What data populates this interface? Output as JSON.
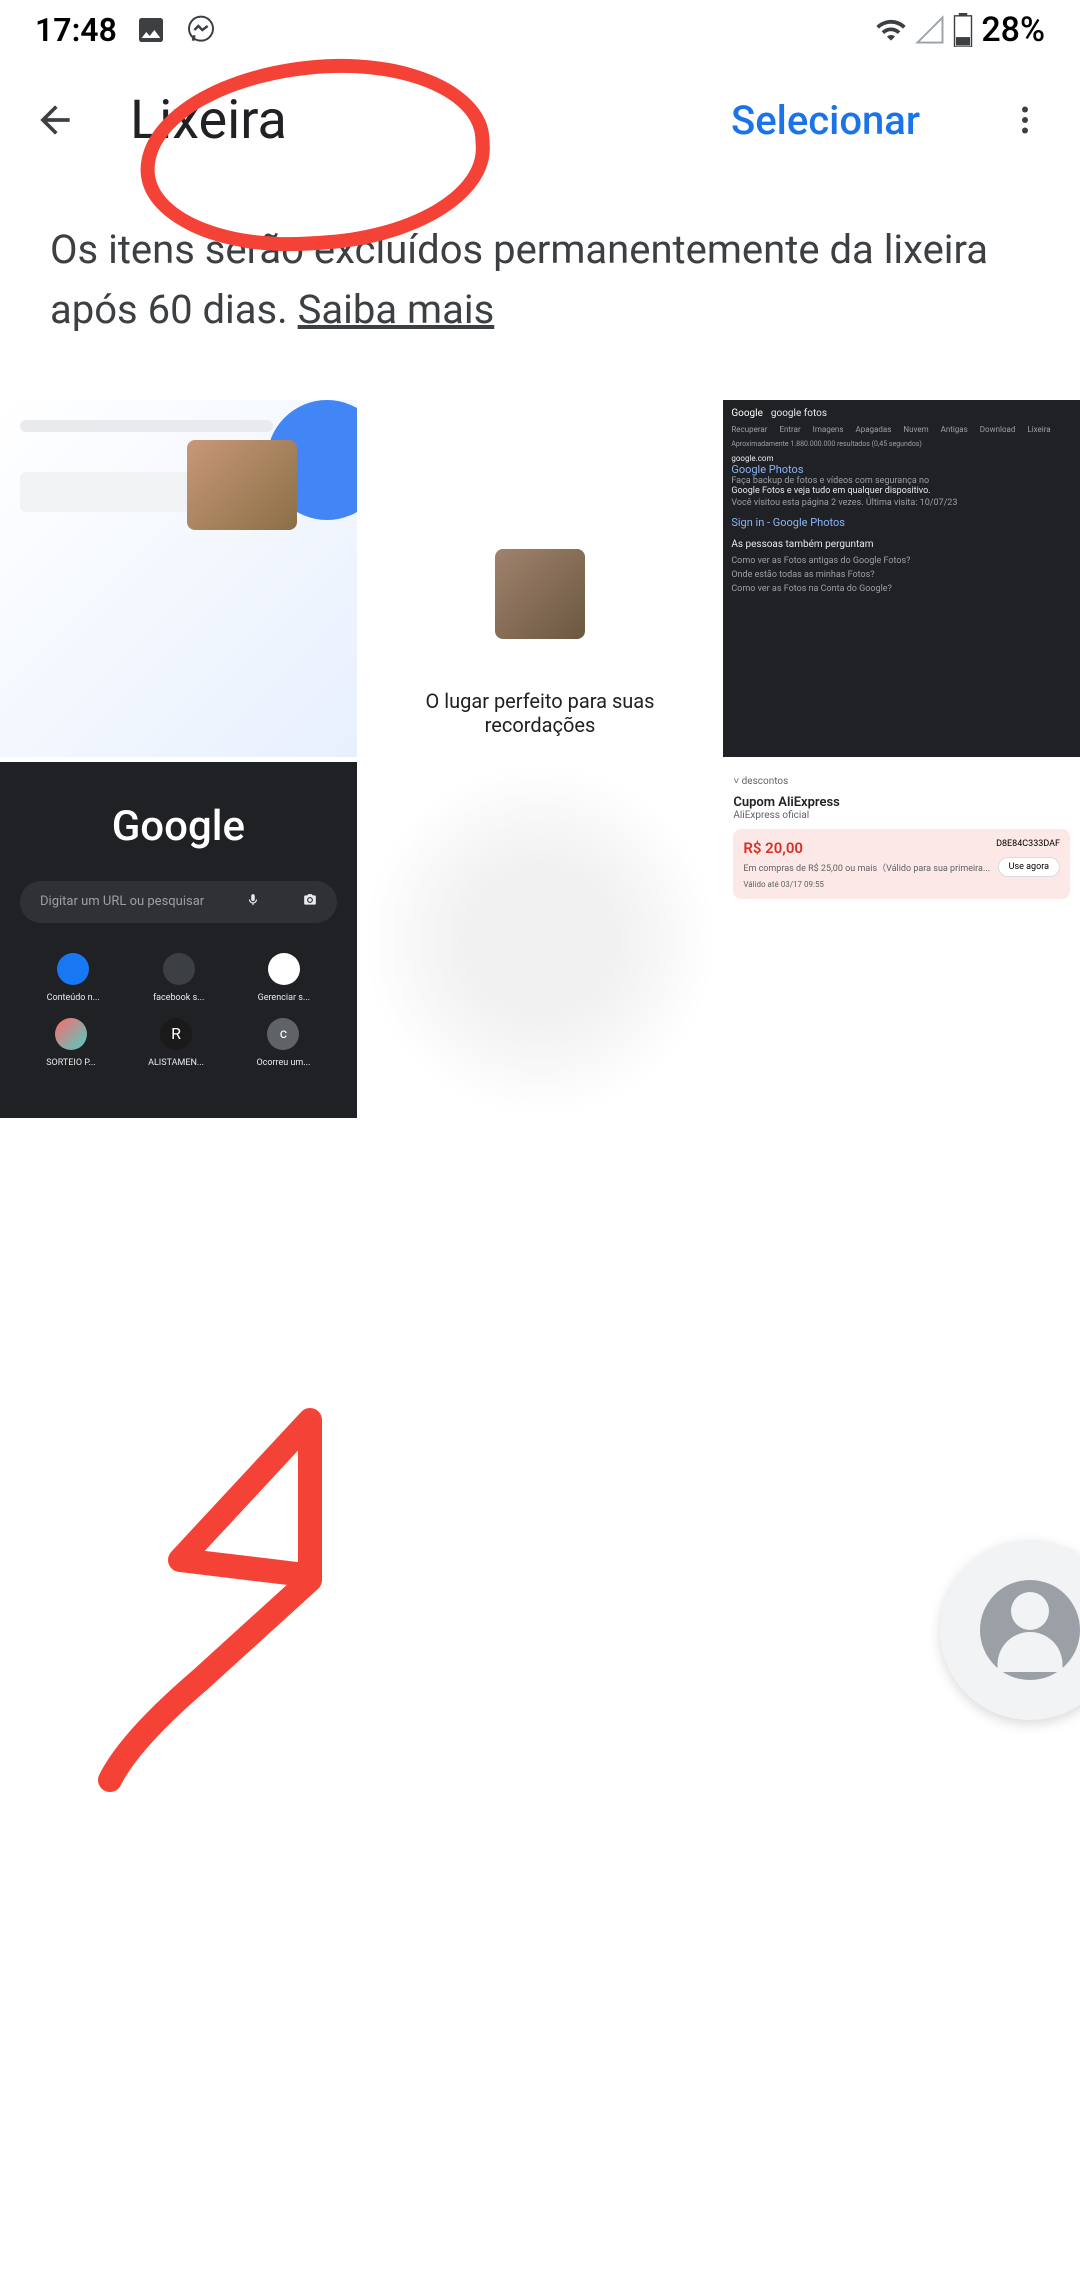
{
  "status_bar": {
    "time": "17:48",
    "battery_percent": "28%"
  },
  "app_bar": {
    "title": "Lixeira",
    "select_label": "Selecionar"
  },
  "info_banner": {
    "text": "Os itens serão excluídos permanentemente da lixeira após 60 dias. ",
    "link_text": "Saiba mais"
  },
  "thumbnails": {
    "photo2_caption": "O lugar perfeito para suas recordações",
    "photo3": {
      "search_term": "google fotos",
      "tabs": [
        "Recuperar",
        "Entrar",
        "Imagens",
        "Apagadas",
        "Nuvem",
        "Antigas",
        "Download",
        "Lixeira"
      ],
      "result_count": "Aproximadamente 1.880.000.000 resultados (0,45 segundos)",
      "url1": "google.com",
      "title1": "Google Photos",
      "desc1": "Faça backup de fotos e vídeos com segurança no",
      "desc1b": "Google Fotos e veja tudo em qualquer dispositivo.",
      "visited": "Você visitou esta página 2 vezes. Última visita: 10/07/23",
      "title2": "Sign in - Google Photos",
      "people_ask": "As pessoas também perguntam",
      "q1": "Como ver as Fotos antigas do Google Fotos?",
      "q2": "Onde estão todas as minhas Fotos?",
      "q3": "Como ver as Fotos na Conta do Google?"
    },
    "photo4": {
      "logo": "Google",
      "search_placeholder": "Digitar um URL ou pesquisar",
      "shortcuts": [
        {
          "label": "Conteúdo n..."
        },
        {
          "label": "facebook s..."
        },
        {
          "label": "Gerenciar s..."
        },
        {
          "label": "SORTEIO P..."
        },
        {
          "label": "ALISTAMEN..."
        },
        {
          "label": "Ocorreu um..."
        }
      ]
    },
    "photo6": {
      "header": "descontos",
      "title": "Cupom AliExpress",
      "subtitle": "AliExpress oficial",
      "price": "R$ 20,00",
      "code": "D8E84C333DAF",
      "desc": "Em compras de R$ 25,00 ou mais（Válido para sua primeira...",
      "button": "Use agora",
      "valid": "Válido até 03/17 09:55"
    }
  }
}
